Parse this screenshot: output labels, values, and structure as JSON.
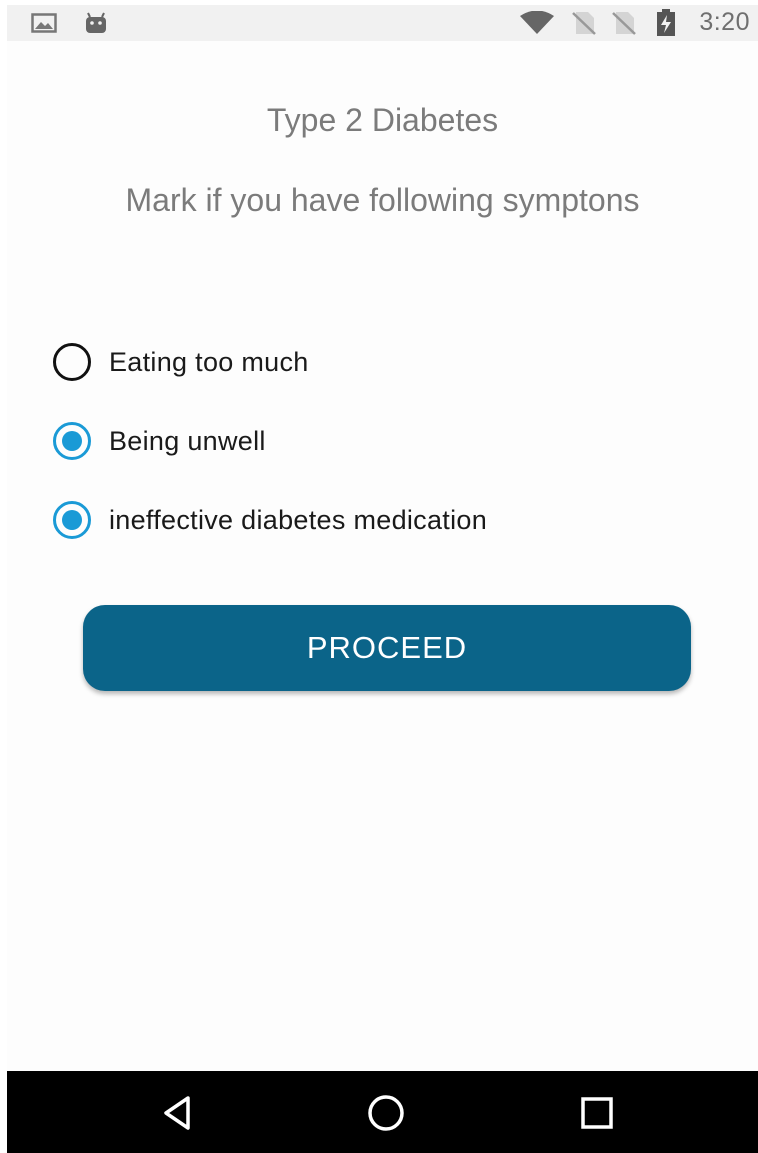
{
  "status_bar": {
    "time": "3:20",
    "icons": [
      "gallery-icon",
      "android-icon",
      "wifi-icon",
      "no-sim-icon",
      "no-sim-icon",
      "battery-charging-icon"
    ]
  },
  "page": {
    "title": "Type 2 Diabetes",
    "subtitle": "Mark if you have following symptons"
  },
  "options": [
    {
      "label": "Eating too much",
      "checked": false
    },
    {
      "label": "Being unwell",
      "checked": true
    },
    {
      "label": "ineffective diabetes medication",
      "checked": true
    }
  ],
  "proceed_button": {
    "label": "PROCEED"
  },
  "nav_bar": {
    "icons": [
      "back-icon",
      "home-icon",
      "recents-icon"
    ]
  },
  "colors": {
    "accent": "#1a9ad6",
    "button": "#0b6489",
    "title_text": "#7b7b7b"
  }
}
